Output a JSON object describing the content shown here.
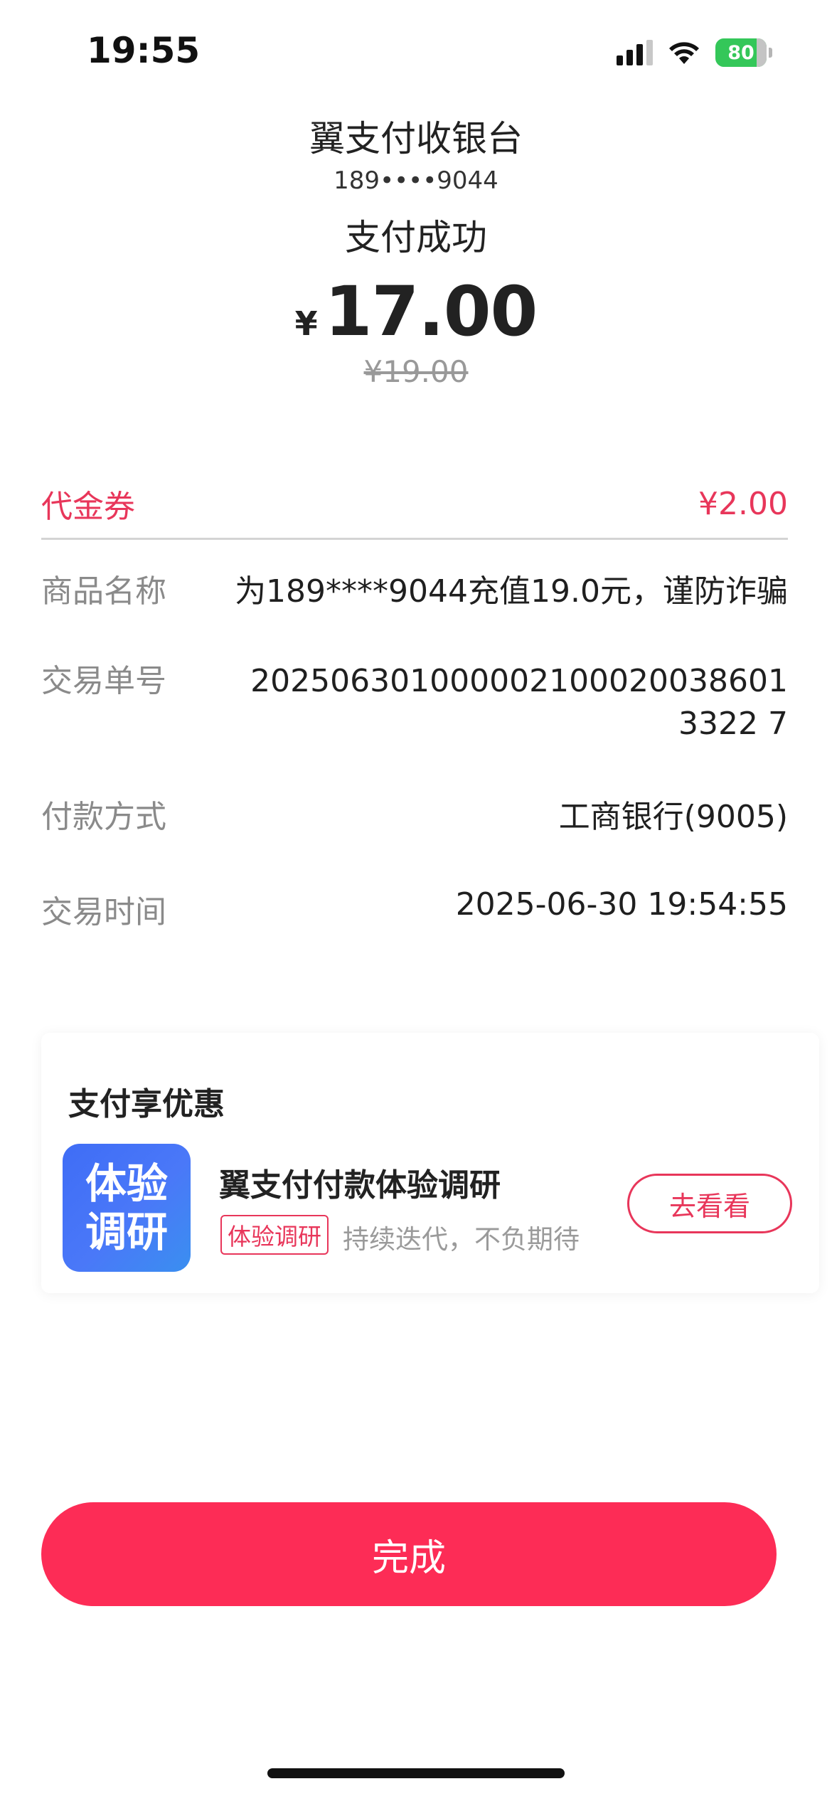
{
  "status_bar": {
    "time": "19:55",
    "battery": "80"
  },
  "header": {
    "cashier_title": "翼支付收银台",
    "phone": "189••••9044",
    "status": "支付成功",
    "currency": "¥",
    "amount": "17.00",
    "original_amount": "¥19.00"
  },
  "coupon": {
    "label": "代金券",
    "value": "¥2.00"
  },
  "details": [
    {
      "label": "商品名称",
      "value": "为189****9044充值19.0元，谨防诈骗"
    },
    {
      "label": "交易单号",
      "value": "2025063010000021000200386013322 7"
    },
    {
      "label": "付款方式",
      "value": "工商银行(9005)"
    },
    {
      "label": "交易时间",
      "value": "2025-06-30 19:54:55"
    }
  ],
  "promo": {
    "title": "支付享优惠",
    "logo_line1": "体验",
    "logo_line2": "调研",
    "name": "翼支付付款体验调研",
    "tag": "体验调研",
    "subtitle": "持续迭代，不负期待",
    "button": "去看看"
  },
  "done_button": "完成",
  "colors": {
    "accent": "#fd2c56",
    "coupon_red": "#e8365a",
    "label_gray": "#8a8a8a"
  }
}
